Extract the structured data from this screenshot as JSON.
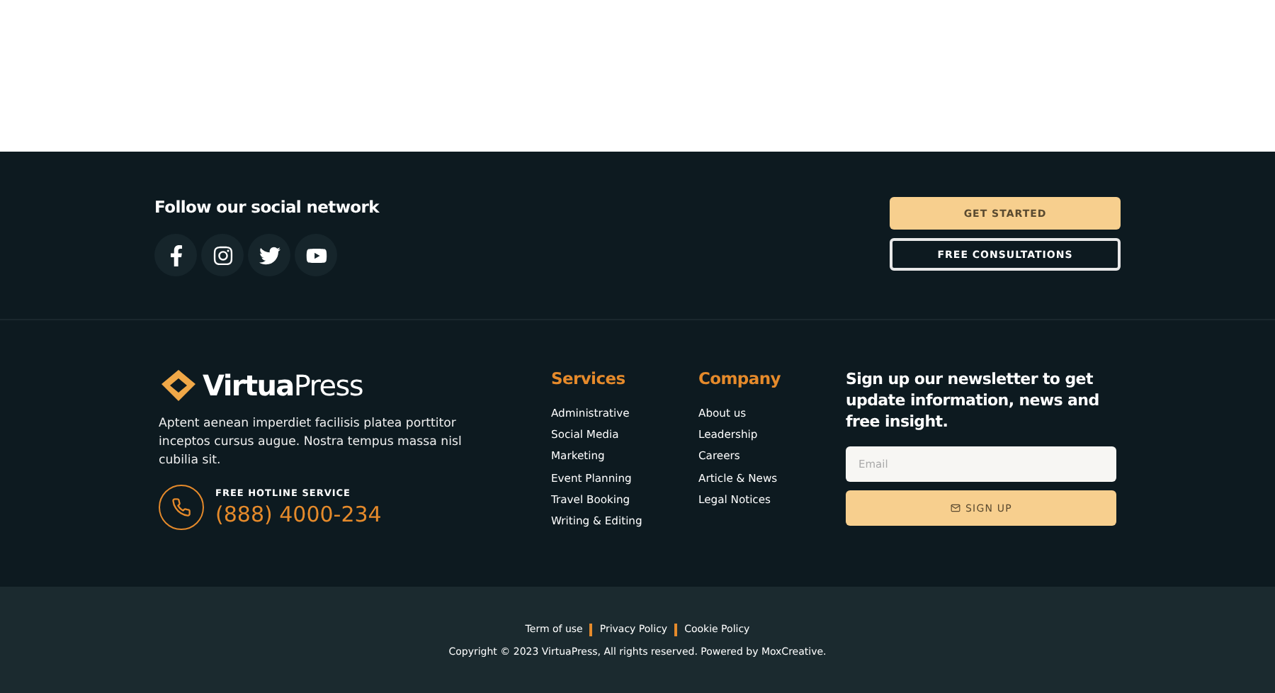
{
  "social": {
    "title": "Follow our social network",
    "links": [
      {
        "kind": "facebook"
      },
      {
        "kind": "instagram"
      },
      {
        "kind": "twitter"
      },
      {
        "kind": "youtube"
      }
    ]
  },
  "cta": {
    "buttons": [
      {
        "label": "GET STARTED",
        "kind": "filled"
      },
      {
        "label": "FREE CONSULTATIONS",
        "kind": "outline"
      }
    ]
  },
  "brand": {
    "logo": "**Virtua**Press",
    "description": "Aptent aenean imperdiet facilisis platea porttitor inceptos cursus augue. Nostra tempus massa nisl cubilia sit.",
    "hotline_label": "FREE HOTLINE SERVICE",
    "hotline_number": "(888) 4000-234"
  },
  "menus": [
    {
      "title": "Services",
      "items": [
        "Administrative",
        "Social Media",
        "Marketing",
        "Event Planning",
        "Travel Booking",
        "Writing & Editing"
      ]
    },
    {
      "title": "Company",
      "items": [
        "About us",
        "Leadership",
        "Careers",
        "Article & News",
        "Legal Notices"
      ]
    }
  ],
  "newsletter": {
    "title": "Sign up our newsletter to get update information, news and free insight.",
    "email": {
      "placeholder": "Email"
    },
    "button": "SIGN UP"
  },
  "bottom": {
    "links": [
      "Term of use",
      "Privacy Policy",
      "Cookie Policy"
    ],
    "copyright": "Copyright © 2023 VirtuaPress, All rights reserved. Powered by MoxCreative."
  }
}
